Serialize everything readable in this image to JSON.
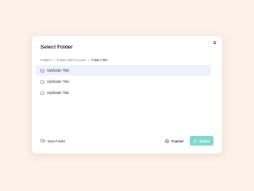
{
  "dialog": {
    "title": "Select Folder",
    "close_icon": "close-icon"
  },
  "breadcrumb": {
    "items": [
      "Folders",
      "Folder with 2 Levels",
      "Folder Title"
    ],
    "separator": "/"
  },
  "folders": [
    {
      "label": "Subfolder Title",
      "selected": true,
      "icon": "folder-icon"
    },
    {
      "label": "Subfolder Title",
      "selected": false,
      "icon": "folder-icon"
    },
    {
      "label": "Subfolder Title",
      "selected": false,
      "icon": "folder-icon"
    }
  ],
  "footer": {
    "new_folder_label": "New Folder",
    "new_folder_icon": "folder-plus-icon",
    "cancel_label": "Cancel",
    "cancel_icon": "cancel-circle-icon",
    "select_label": "Select",
    "select_icon": "check-circle-icon"
  },
  "colors": {
    "background": "#fdf0e8",
    "selected_row": "#edf1fb",
    "primary_button": "#7ed8cd",
    "text": "#2b2b33"
  }
}
